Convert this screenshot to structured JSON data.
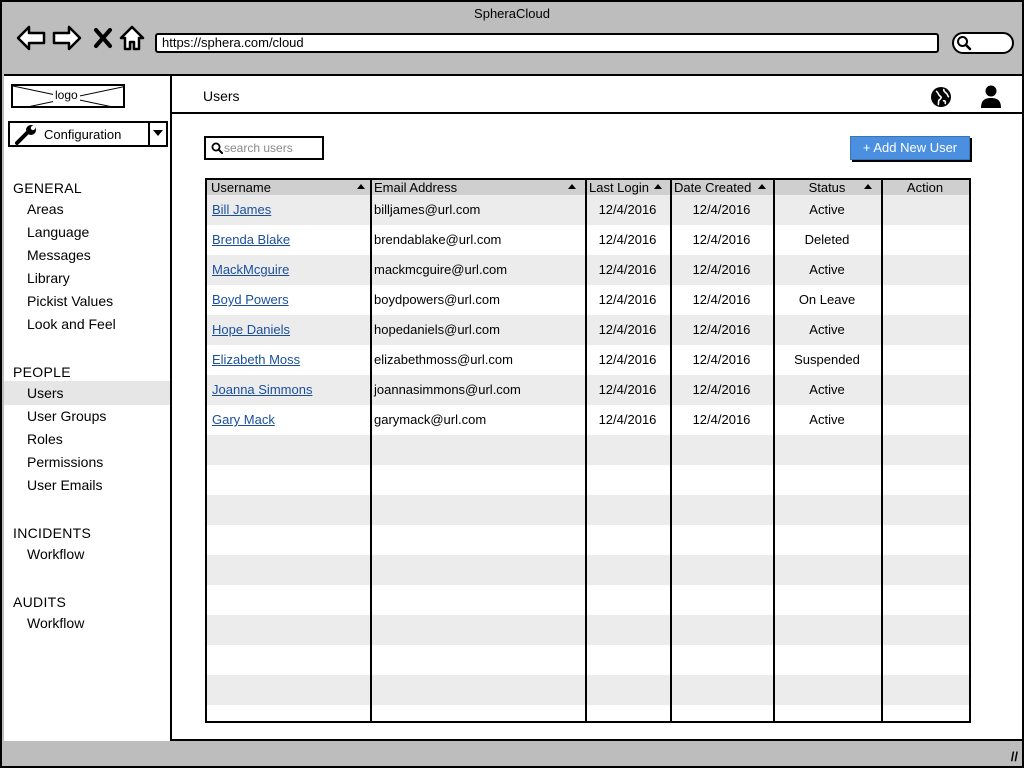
{
  "browser": {
    "title": "SpheraCloud",
    "url": "https://sphera.com/cloud"
  },
  "sidebar": {
    "logo_text": "logo",
    "config_select": {
      "value": "Configuration"
    },
    "sections": [
      {
        "title": "GENERAL",
        "items": [
          "Areas",
          "Language",
          "Messages",
          "Library",
          "Pickist Values",
          "Look and Feel"
        ]
      },
      {
        "title": "PEOPLE",
        "items": [
          "Users",
          "User Groups",
          "Roles",
          "Permissions",
          "User Emails"
        ]
      },
      {
        "title": "INCIDENTS",
        "items": [
          "Workflow"
        ]
      },
      {
        "title": "AUDITS",
        "items": [
          "Workflow"
        ]
      }
    ],
    "active_item": "Users"
  },
  "header": {
    "title": "Users"
  },
  "toolbar": {
    "search_placeholder": "search users",
    "add_button_label": "+ Add New User"
  },
  "table": {
    "columns": [
      "Username",
      "Email Address",
      "Last Login",
      "Date Created",
      "Status",
      "Action"
    ],
    "rows": [
      {
        "username": "Bill James",
        "email": "billjames@url.com",
        "last_login": "12/4/2016",
        "date_created": "12/4/2016",
        "status": "Active"
      },
      {
        "username": "Brenda Blake",
        "email": "brendablake@url.com",
        "last_login": "12/4/2016",
        "date_created": "12/4/2016",
        "status": "Deleted"
      },
      {
        "username": "MackMcguire",
        "email": "mackmcguire@url.com",
        "last_login": "12/4/2016",
        "date_created": "12/4/2016",
        "status": "Active"
      },
      {
        "username": "Boyd Powers",
        "email": "boydpowers@url.com",
        "last_login": "12/4/2016",
        "date_created": "12/4/2016",
        "status": "On Leave"
      },
      {
        "username": "Hope Daniels",
        "email": "hopedaniels@url.com",
        "last_login": "12/4/2016",
        "date_created": "12/4/2016",
        "status": "Active"
      },
      {
        "username": "Elizabeth Moss",
        "email": "elizabethmoss@url.com",
        "last_login": "12/4/2016",
        "date_created": "12/4/2016",
        "status": "Suspended"
      },
      {
        "username": "Joanna Simmons",
        "email": "joannasimmons@url.com",
        "last_login": "12/4/2016",
        "date_created": "12/4/2016",
        "status": "Active"
      },
      {
        "username": "Gary Mack",
        "email": "garymack@url.com",
        "last_login": "12/4/2016",
        "date_created": "12/4/2016",
        "status": "Active"
      }
    ]
  },
  "colors": {
    "chrome": "#bdbdbd",
    "accent": "#4b8fe0",
    "link": "#1a4f9c",
    "row_stripe": "#ececec",
    "header_fill": "#cfcfcf"
  }
}
